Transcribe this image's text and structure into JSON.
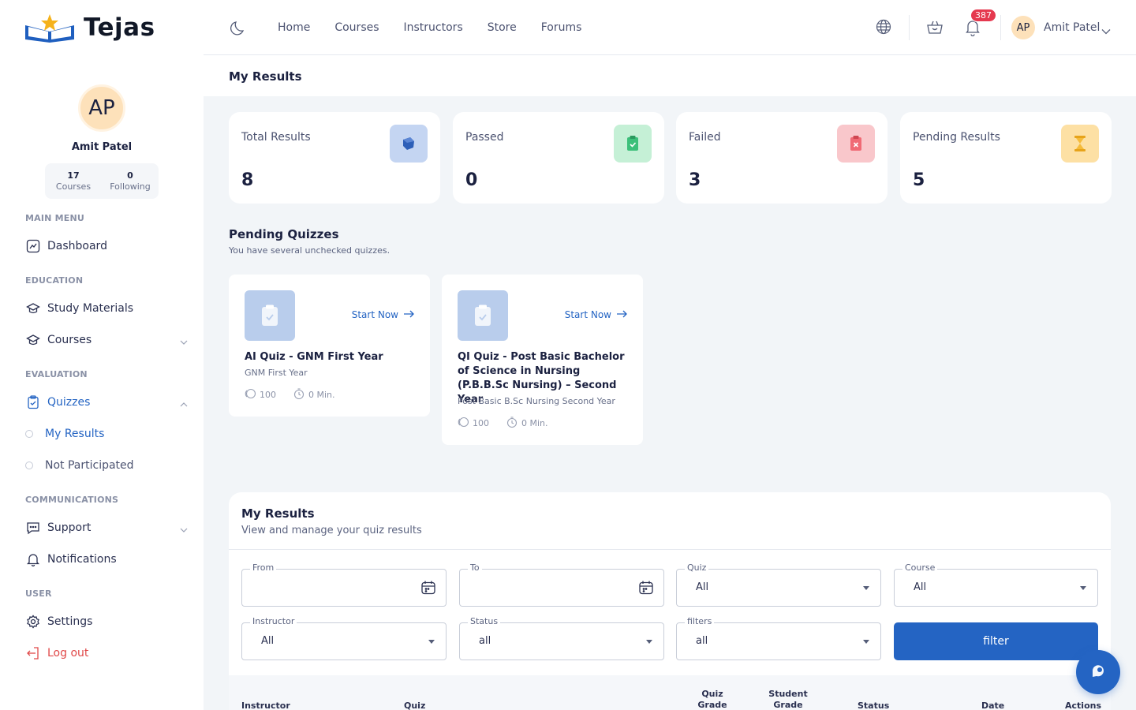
{
  "brand": {
    "name": "Tejas"
  },
  "profile": {
    "initials": "AP",
    "name": "Amit Patel",
    "stats": [
      {
        "value": "17",
        "label": "Courses"
      },
      {
        "value": "0",
        "label": "Following"
      }
    ]
  },
  "sidebar": {
    "sections": {
      "main_menu": "MAIN MENU",
      "education": "EDUCATION",
      "evaluation": "EVALUATION",
      "communications": "COMMUNICATIONS",
      "user": "USER"
    },
    "items": {
      "dashboard": "Dashboard",
      "study_materials": "Study Materials",
      "courses": "Courses",
      "quizzes": "Quizzes",
      "my_results": "My Results",
      "not_participated": "Not Participated",
      "support": "Support",
      "notifications": "Notifications",
      "settings": "Settings",
      "logout": "Log out"
    }
  },
  "topbar": {
    "nav": [
      "Home",
      "Courses",
      "Instructors",
      "Store",
      "Forums"
    ],
    "notification_count": "387",
    "user_initials": "AP",
    "user_name": "Amit Patel"
  },
  "page": {
    "title": "My Results"
  },
  "stat_cards": [
    {
      "label": "Total Results",
      "value": "8",
      "icon": "box-icon",
      "color": "#c4d5f2"
    },
    {
      "label": "Passed",
      "value": "0",
      "icon": "clipboard-check-icon",
      "color": "#c5f0d6"
    },
    {
      "label": "Failed",
      "value": "3",
      "icon": "clipboard-x-icon",
      "color": "#f9c7cb"
    },
    {
      "label": "Pending Results",
      "value": "5",
      "icon": "hourglass-icon",
      "color": "#fde0a4"
    }
  ],
  "pending_quizzes": {
    "title": "Pending Quizzes",
    "subtitle": "You have several unchecked quizzes.",
    "start_label": "Start Now",
    "items": [
      {
        "title": "AI Quiz - GNM First Year",
        "course": "GNM First Year",
        "score": "100",
        "duration": "0 Min."
      },
      {
        "title": "QI Quiz - Post Basic Bachelor of Science in Nursing (P.B.B.Sc Nursing) – Second Year",
        "course": "Post Basic B.Sc Nursing Second Year",
        "score": "100",
        "duration": "0 Min."
      }
    ]
  },
  "results": {
    "title": "My Results",
    "subtitle": "View and manage your quiz results",
    "filters": {
      "from": {
        "label": "From",
        "value": ""
      },
      "to": {
        "label": "To",
        "value": ""
      },
      "quiz": {
        "label": "Quiz",
        "value": "All"
      },
      "course": {
        "label": "Course",
        "value": "All"
      },
      "instructor": {
        "label": "Instructor",
        "value": "All"
      },
      "status": {
        "label": "Status",
        "value": "all"
      },
      "filters": {
        "label": "filters",
        "value": "all"
      }
    },
    "filter_button": "filter",
    "columns": {
      "instructor": "Instructor",
      "quiz": "Quiz",
      "quiz_grade": "Quiz Grade",
      "student_grade": "Student Grade",
      "status": "Status",
      "date": "Date",
      "actions": "Actions"
    }
  },
  "colors": {
    "accent": "#2464c3",
    "danger": "#e04848",
    "badge": "#e5394f"
  }
}
